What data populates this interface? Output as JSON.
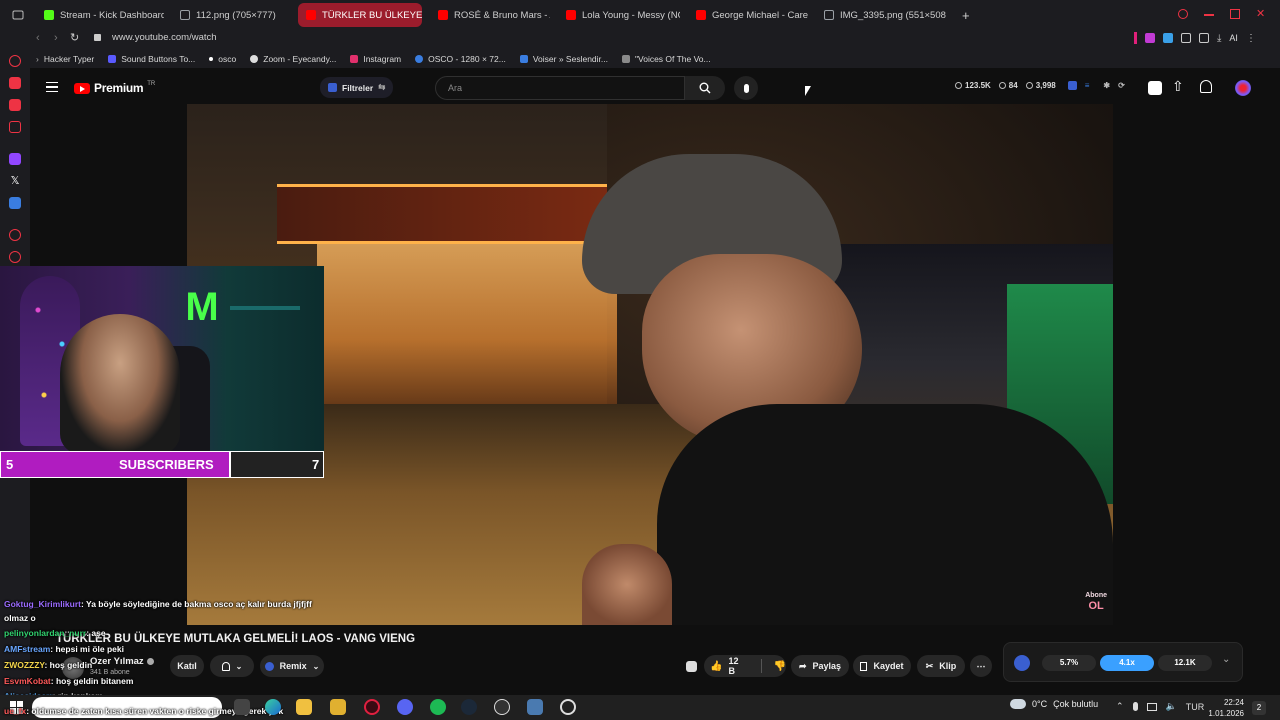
{
  "browser": {
    "tabs": [
      {
        "label": "Stream - Kick Dashboard",
        "color": "#53fc18",
        "active": false
      },
      {
        "label": "112.png (705×777)",
        "color": "#9aa0a6",
        "active": false
      },
      {
        "label": "TÜRKLER BU ÜLKEYE",
        "color": "#ff0000",
        "active": true
      },
      {
        "label": "ROSÉ & Bruno Mars - APT",
        "color": "#ff0000",
        "active": false
      },
      {
        "label": "Lola Young - Messy (NOV",
        "color": "#ff0000",
        "active": false
      },
      {
        "label": "George Michael - Careles",
        "color": "#ff0000",
        "active": false
      },
      {
        "label": "IMG_3395.png (551×508)",
        "color": "#9aa0a6",
        "active": false
      }
    ],
    "new_tab_label": "+",
    "url": "www.youtube.com/watch",
    "bookmarks": [
      "Hacker Typer",
      "Sound Buttons To...",
      "osco",
      "Zoom - Eyecandy...",
      "Instagram",
      "OSCO - 1280 × 72...",
      "Voiser » Seslendir...",
      "\"Voices Of The Vo..."
    ],
    "ai_label": "AI"
  },
  "youtube": {
    "logo_text": "Premium",
    "logo_sup": "TR",
    "filter_label": "Filtreler",
    "search_placeholder": "Ara",
    "stats": [
      "123.5K",
      "84",
      "3,998"
    ],
    "video_title": "TÜRKLER BU ÜLKEYE MUTLAKA GELMELİ! LAOS - VANG VIENG",
    "channel_name": "Ozer Yılmaz",
    "subscribers": "341 B abone",
    "join_label": "Katıl",
    "remix_label": "Remix",
    "like_count": "12 B",
    "share_label": "Paylaş",
    "save_label": "Kaydet",
    "clip_label": "Klip",
    "metrics": [
      "5.7%",
      "4.1x",
      "12.1K"
    ],
    "abone_ol_lines": [
      "Abone",
      "OL"
    ]
  },
  "stream_overlay": {
    "subscribers_label": "SUBSCRIBERS",
    "subs_current": "5",
    "subs_goal": "7",
    "chat": [
      {
        "user": "Goktug_Kirimlikurt",
        "color": "#9b6bff",
        "text": ": Ya böyle söylediğine de bakma osco aç kalır burda jfjfjff"
      },
      {
        "user": "",
        "color": "#ffffff",
        "text": "olmaz o"
      },
      {
        "user": "pelinyonlardan_nurr",
        "color": "#31d36f",
        "text": ": aşe"
      },
      {
        "user": "AMFstream",
        "color": "#6aa7ff",
        "text": ": hepsi mi öle peki"
      },
      {
        "user": "ZWOZZZY",
        "color": "#f2d44b",
        "text": ": hoş geldin"
      },
      {
        "user": "EsvmKobat",
        "color": "#ff5a5a",
        "text": ": hoş geldin bitanem"
      },
      {
        "user": "Alicesidserr",
        "color": "#5ab0ff",
        "text": ": rip kankam"
      },
      {
        "user": "ue_fx",
        "color": "#ff5a5a",
        "text": ": oldumse de zaten kısa süren vakten o riske girmeye gerek yok"
      }
    ]
  },
  "taskbar": {
    "weather_temp": "0°C",
    "weather_text": "Çok bulutlu",
    "lang": "TUR",
    "time": "22:24",
    "date": "1.01.2026"
  }
}
